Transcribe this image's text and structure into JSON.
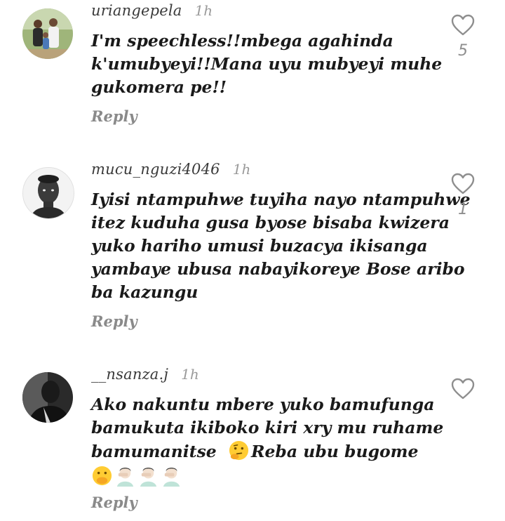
{
  "comments": [
    {
      "username": "uriangepela",
      "time": "1h",
      "lines": [
        "I'm speechless!!mbega agahinda",
        "k'umubyeyi!!Mana uyu mubyeyi muhe",
        "gukomera pe!!"
      ],
      "reply_label": "Reply",
      "likes": "5",
      "avatar_icon": "family-photo-avatar"
    },
    {
      "username": "mucu_nguzi4046",
      "time": "1h",
      "lines": [
        "Iyisi ntampuhwe tuyiha nayo ntampuhwe",
        "itez kuduha gusa byose bisaba kwizera",
        "yuko hariho umusi buzacya ikisanga",
        "yambaye ubusa nabayikoreye Bose aribo",
        "ba kazungu"
      ],
      "reply_label": "Reply",
      "likes": "1",
      "avatar_icon": "man-portrait-avatar"
    },
    {
      "username": "__nsanza.j",
      "time": "1h",
      "lines": [
        "Ako nakuntu mbere yuko bamufunga",
        "bamukuta ikiboko kiri xry mu ruhame",
        "bamumanitse",
        "Reba ubu bugome"
      ],
      "reply_label": "Reply",
      "likes": "",
      "avatar_icon": "dark-portrait-avatar",
      "emojis": [
        "thinking-face",
        "face-with-hand-over-mouth",
        "man-facepalming",
        "man-facepalming",
        "man-facepalming"
      ]
    }
  ],
  "colors": {
    "text": "#1a1a1a",
    "secondary": "#8a8a8a",
    "icon": "#8e8e8e"
  }
}
